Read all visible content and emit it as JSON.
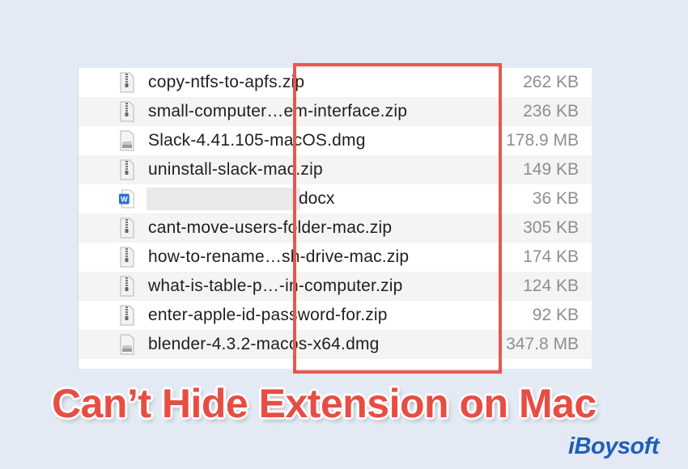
{
  "files": [
    {
      "name": "copy-ntfs-to-apfs.zip",
      "size": "262 KB",
      "icon": "zip-icon"
    },
    {
      "name": "small-computer…em-interface.zip",
      "size": "236 KB",
      "icon": "zip-icon"
    },
    {
      "name": "Slack-4.41.105-macOS.dmg",
      "size": "178.9 MB",
      "icon": "dmg-icon"
    },
    {
      "name": "uninstall-slack-mac.zip",
      "size": "149 KB",
      "icon": "zip-icon"
    },
    {
      "name": "docx",
      "size": "36 KB",
      "icon": "word-doc-icon",
      "redacted": true
    },
    {
      "name": "cant-move-users-folder-mac.zip",
      "size": "305 KB",
      "icon": "zip-icon"
    },
    {
      "name": "how-to-rename…sh-drive-mac.zip",
      "size": "174 KB",
      "icon": "zip-icon"
    },
    {
      "name": "what-is-table-p…-in-computer.zip",
      "size": "124 KB",
      "icon": "zip-icon"
    },
    {
      "name": "enter-apple-id-password-for.zip",
      "size": "92 KB",
      "icon": "zip-icon"
    },
    {
      "name": "blender-4.3.2-macos-x64.dmg",
      "size": "347.8 MB",
      "icon": "dmg-icon"
    }
  ],
  "headline": "Can’t Hide Extension on Mac",
  "brand": "iBoysoft",
  "colors": {
    "highlight": "#e8574f",
    "headline": "#e84d43",
    "brand": "#1f5fb8"
  }
}
